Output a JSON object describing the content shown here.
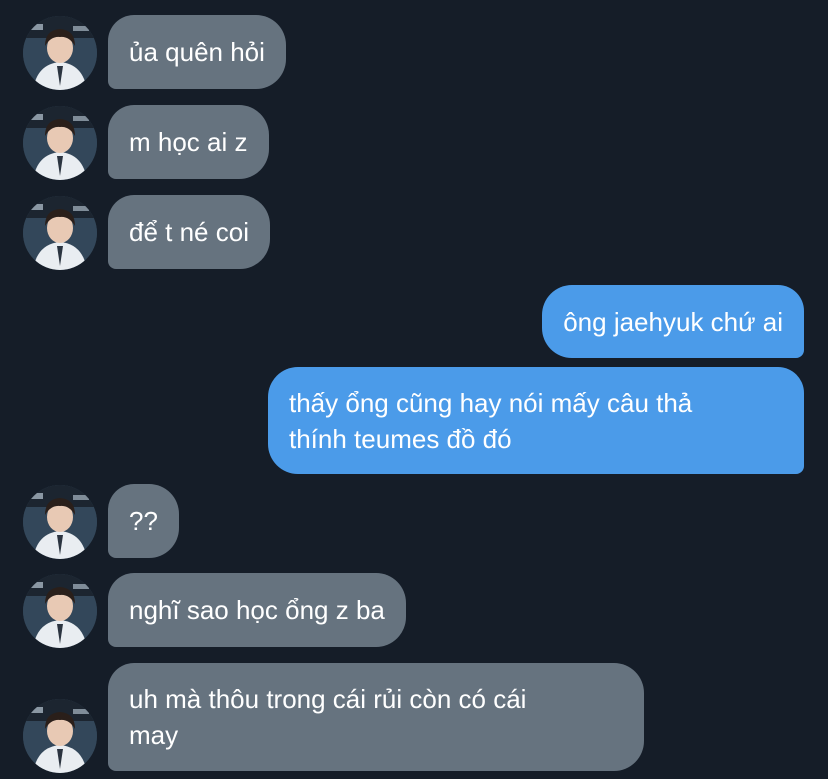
{
  "colors": {
    "background": "#151d28",
    "incoming_bubble": "#66737f",
    "outgoing_bubble": "#4b9be9",
    "text": "#ffffff"
  },
  "messages": [
    {
      "direction": "incoming",
      "text": "ủa quên hỏi",
      "avatar": "contact-avatar"
    },
    {
      "direction": "incoming",
      "text": "m học ai z",
      "avatar": "contact-avatar"
    },
    {
      "direction": "incoming",
      "text": "để t né coi",
      "avatar": "contact-avatar"
    },
    {
      "direction": "outgoing",
      "text": "ông jaehyuk chứ ai"
    },
    {
      "direction": "outgoing",
      "text": "thấy ổng cũng hay nói mấy câu thả\nthính teumes đồ đó"
    },
    {
      "direction": "incoming",
      "text": "??",
      "avatar": "contact-avatar"
    },
    {
      "direction": "incoming",
      "text": "nghĩ sao học ổng z ba",
      "avatar": "contact-avatar"
    },
    {
      "direction": "incoming",
      "text": "uh mà thôu trong cái rủi còn có cái\nmay",
      "avatar": "contact-avatar"
    }
  ]
}
